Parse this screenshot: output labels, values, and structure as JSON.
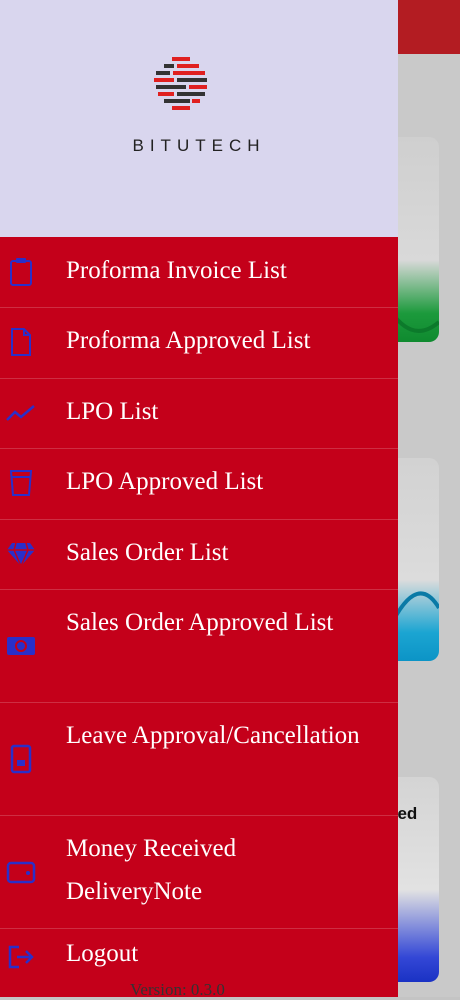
{
  "brand": {
    "name": "BITUTECH"
  },
  "menu": {
    "items": [
      {
        "label": "Proforma Invoice List",
        "icon": "clipboard-icon"
      },
      {
        "label": "Proforma Approved List",
        "icon": "file-icon"
      },
      {
        "label": "LPO List",
        "icon": "trending-icon"
      },
      {
        "label": "LPO Approved List",
        "icon": "cup-icon"
      },
      {
        "label": "Sales Order List",
        "icon": "diamond-icon"
      },
      {
        "label": "Sales Order Approved List",
        "icon": "money-icon"
      },
      {
        "label": "Leave Approval/Cancellation",
        "icon": "tablet-icon"
      },
      {
        "label": "Money Received DeliveryNote",
        "icon": "wallet-icon"
      },
      {
        "label": "Logout",
        "icon": "logout-icon"
      }
    ]
  },
  "footer": {
    "version": "Version: 0.3.0"
  },
  "background": {
    "card_label": "ved"
  },
  "colors": {
    "menu_bg": "#c4001a",
    "header_bg": "#d9d6ee",
    "topbar": "#b31c22"
  }
}
